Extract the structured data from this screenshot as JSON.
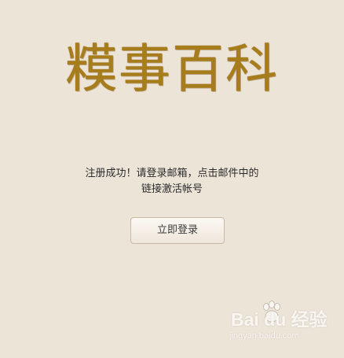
{
  "title": "糢事百科",
  "message": {
    "line1": "注册成功！请登录邮箱，点击邮件中的",
    "line2": "链接激活帐号"
  },
  "button": {
    "login_label": "立即登录"
  },
  "watermark": {
    "brand_text": "Bai du 经验",
    "url": "jingyan.baidu.com",
    "icon": "paw-icon"
  },
  "colors": {
    "background": "#EDE4D8",
    "title": "#A77C1A",
    "text": "#2B2B2B",
    "button_border": "#C9B9A6"
  }
}
